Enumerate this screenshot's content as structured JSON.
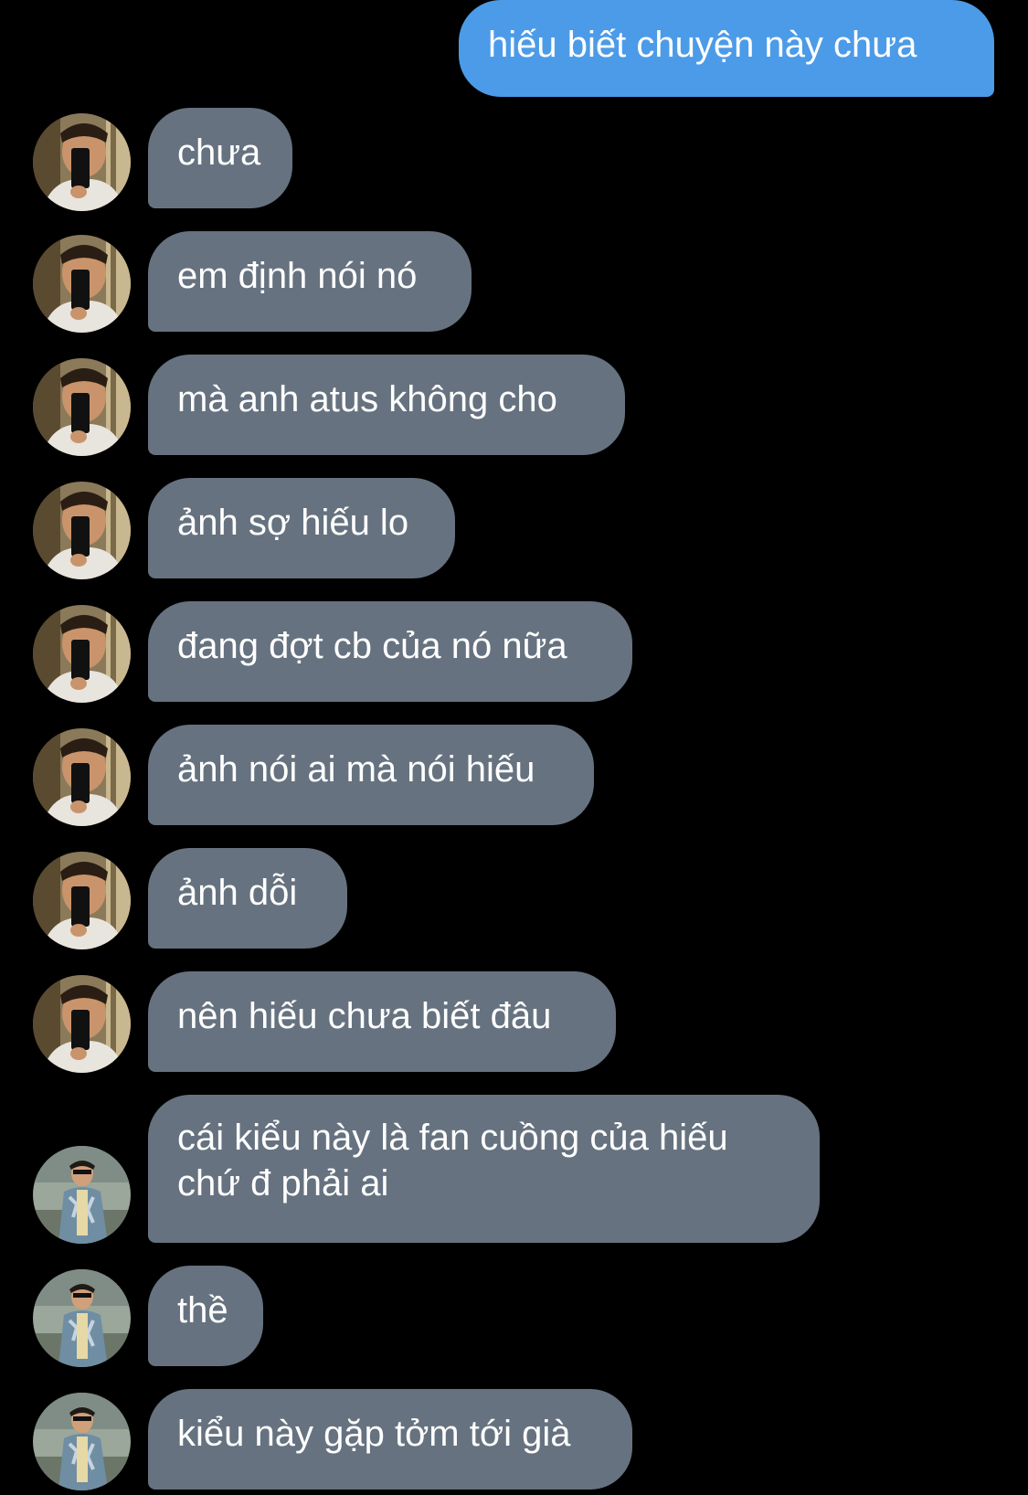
{
  "conversation": {
    "outgoing": [
      {
        "text": "hiếu biết chuyện này chưa"
      }
    ],
    "incoming": [
      {
        "text": "chưa",
        "avatar": "profile-photo-mirror-selfie"
      },
      {
        "text": "em định nói nó",
        "avatar": "profile-photo-mirror-selfie"
      },
      {
        "text": "mà anh atus không cho",
        "avatar": "profile-photo-mirror-selfie"
      },
      {
        "text": "ảnh sợ hiếu lo",
        "avatar": "profile-photo-mirror-selfie"
      },
      {
        "text": "đang đợt cb của nó nữa",
        "avatar": "profile-photo-mirror-selfie"
      },
      {
        "text": "ảnh nói ai mà nói hiếu",
        "avatar": "profile-photo-mirror-selfie"
      },
      {
        "text": "ảnh dỗi",
        "avatar": "profile-photo-mirror-selfie"
      },
      {
        "text": "nên hiếu chưa biết đâu",
        "avatar": "profile-photo-mirror-selfie"
      },
      {
        "text": "cái kiểu này là fan cuồng của hiếu chứ đ phải ai",
        "avatar": "profile-photo-outdoor"
      },
      {
        "text": "thề",
        "avatar": "profile-photo-outdoor"
      },
      {
        "text": "kiểu này gặp tởm tới già",
        "avatar": "profile-photo-outdoor"
      }
    ]
  },
  "colors": {
    "background": "#000000",
    "outgoing_bubble": "#4c9be8",
    "incoming_bubble": "#66727f",
    "text": "#ffffff"
  }
}
